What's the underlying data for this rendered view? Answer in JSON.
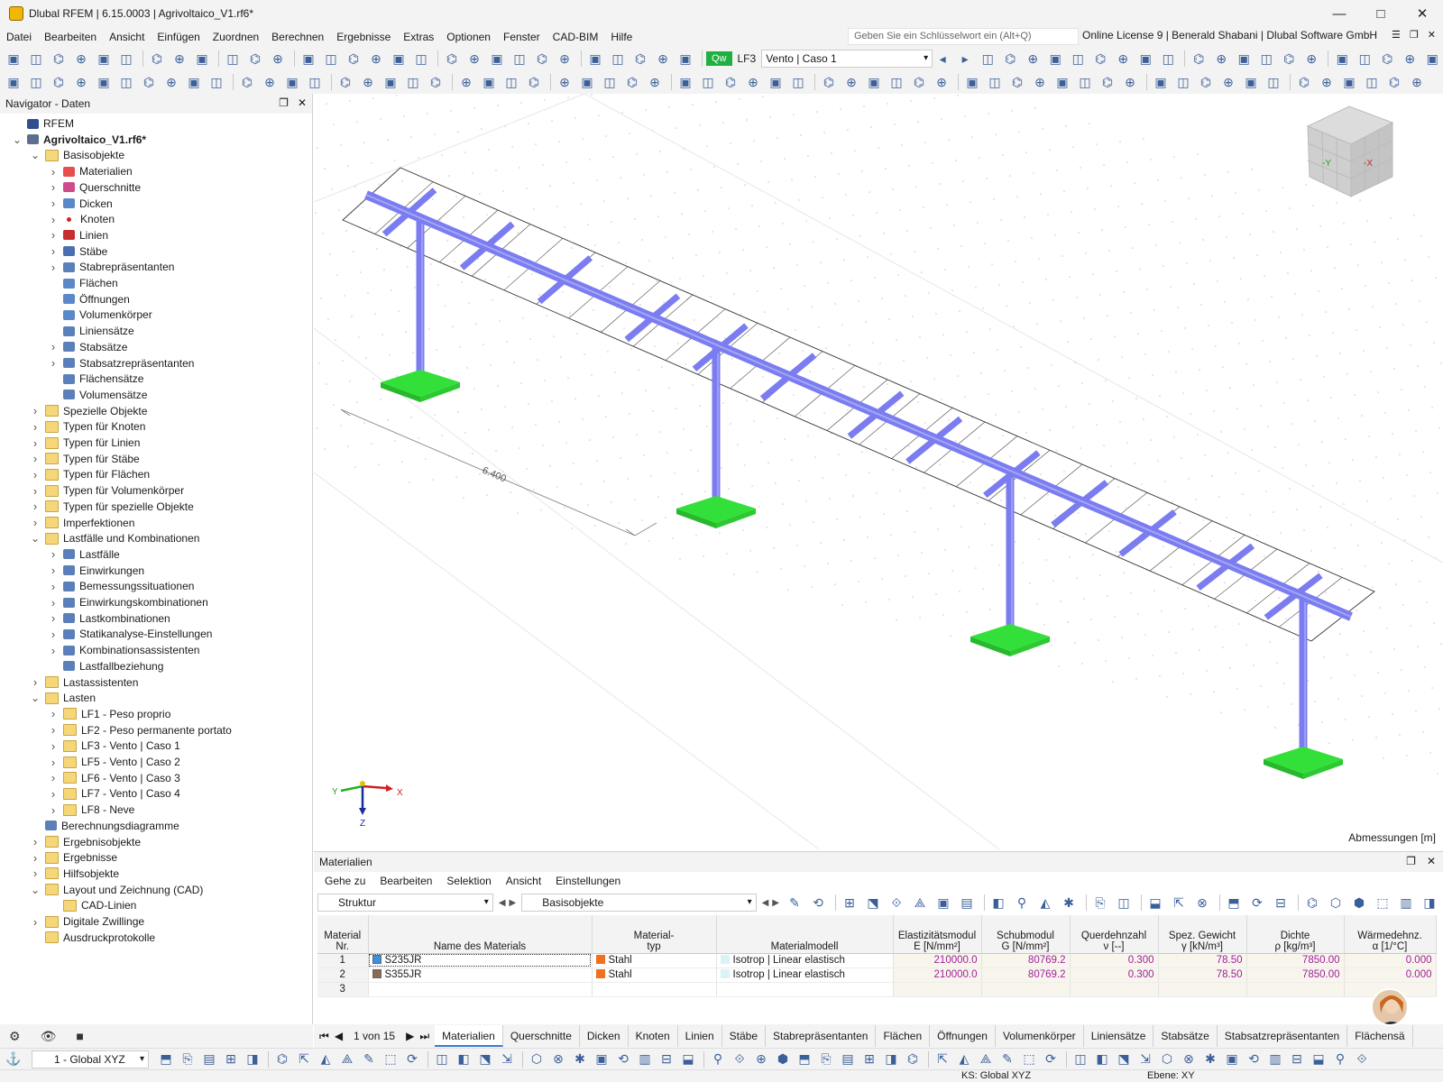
{
  "window": {
    "title": "Dlubal RFEM | 6.15.0003 | Agrivoltaico_V1.rf6*"
  },
  "menu": [
    "Datei",
    "Bearbeiten",
    "Ansicht",
    "Einfügen",
    "Zuordnen",
    "Berechnen",
    "Ergebnisse",
    "Extras",
    "Optionen",
    "Fenster",
    "CAD-BIM",
    "Hilfe"
  ],
  "search": {
    "placeholder": "Geben Sie ein Schlüsselwort ein (Alt+Q)"
  },
  "license": "Online License 9 | Benerald Shabani | Dlubal Software GmbH",
  "loadcase": {
    "badge": "Qw",
    "code": "LF3",
    "name": "Vento | Caso 1"
  },
  "navigator": {
    "title": "Navigator - Daten",
    "items": [
      {
        "label": "RFEM",
        "lvl": 0,
        "exp": "",
        "icon": "rfem-icon"
      },
      {
        "label": "Agrivoltaico_V1.rf6*",
        "lvl": 0,
        "exp": "open",
        "icon": "model-file-icon",
        "bold": true
      },
      {
        "label": "Basisobjekte",
        "lvl": 1,
        "exp": "open",
        "icon": "folder-icon"
      },
      {
        "label": "Materialien",
        "lvl": 2,
        "exp": "closed",
        "icon": "materials-icon"
      },
      {
        "label": "Querschnitte",
        "lvl": 2,
        "exp": "closed",
        "icon": "sections-icon"
      },
      {
        "label": "Dicken",
        "lvl": 2,
        "exp": "closed",
        "icon": "thickness-icon"
      },
      {
        "label": "Knoten",
        "lvl": 2,
        "exp": "closed",
        "icon": "node-icon"
      },
      {
        "label": "Linien",
        "lvl": 2,
        "exp": "closed",
        "icon": "line-icon"
      },
      {
        "label": "Stäbe",
        "lvl": 2,
        "exp": "closed",
        "icon": "member-icon"
      },
      {
        "label": "Stabrepräsentanten",
        "lvl": 2,
        "exp": "closed",
        "icon": "member-rep-icon"
      },
      {
        "label": "Flächen",
        "lvl": 2,
        "exp": "",
        "icon": "surface-icon"
      },
      {
        "label": "Öffnungen",
        "lvl": 2,
        "exp": "",
        "icon": "opening-icon"
      },
      {
        "label": "Volumenkörper",
        "lvl": 2,
        "exp": "",
        "icon": "solid-icon"
      },
      {
        "label": "Liniensätze",
        "lvl": 2,
        "exp": "",
        "icon": "line-set-icon"
      },
      {
        "label": "Stabsätze",
        "lvl": 2,
        "exp": "closed",
        "icon": "member-set-icon"
      },
      {
        "label": "Stabsatzrepräsentanten",
        "lvl": 2,
        "exp": "closed",
        "icon": "member-set-rep-icon"
      },
      {
        "label": "Flächensätze",
        "lvl": 2,
        "exp": "",
        "icon": "surface-set-icon"
      },
      {
        "label": "Volumensätze",
        "lvl": 2,
        "exp": "",
        "icon": "solid-set-icon"
      },
      {
        "label": "Spezielle Objekte",
        "lvl": 1,
        "exp": "closed",
        "icon": "folder-icon"
      },
      {
        "label": "Typen für Knoten",
        "lvl": 1,
        "exp": "closed",
        "icon": "folder-icon"
      },
      {
        "label": "Typen für Linien",
        "lvl": 1,
        "exp": "closed",
        "icon": "folder-icon"
      },
      {
        "label": "Typen für Stäbe",
        "lvl": 1,
        "exp": "closed",
        "icon": "folder-icon"
      },
      {
        "label": "Typen für Flächen",
        "lvl": 1,
        "exp": "closed",
        "icon": "folder-icon"
      },
      {
        "label": "Typen für Volumenkörper",
        "lvl": 1,
        "exp": "closed",
        "icon": "folder-icon"
      },
      {
        "label": "Typen für spezielle Objekte",
        "lvl": 1,
        "exp": "closed",
        "icon": "folder-icon"
      },
      {
        "label": "Imperfektionen",
        "lvl": 1,
        "exp": "closed",
        "icon": "folder-icon"
      },
      {
        "label": "Lastfälle und Kombinationen",
        "lvl": 1,
        "exp": "open",
        "icon": "folder-icon"
      },
      {
        "label": "Lastfälle",
        "lvl": 2,
        "exp": "closed",
        "icon": "load-case-icon"
      },
      {
        "label": "Einwirkungen",
        "lvl": 2,
        "exp": "closed",
        "icon": "actions-icon"
      },
      {
        "label": "Bemessungssituationen",
        "lvl": 2,
        "exp": "closed",
        "icon": "design-situation-icon"
      },
      {
        "label": "Einwirkungskombinationen",
        "lvl": 2,
        "exp": "closed",
        "icon": "action-combination-icon"
      },
      {
        "label": "Lastkombinationen",
        "lvl": 2,
        "exp": "closed",
        "icon": "load-combination-icon"
      },
      {
        "label": "Statikanalyse-Einstellungen",
        "lvl": 2,
        "exp": "closed",
        "icon": "analysis-settings-icon"
      },
      {
        "label": "Kombinationsassistenten",
        "lvl": 2,
        "exp": "closed",
        "icon": "combination-wizard-icon"
      },
      {
        "label": "Lastfallbeziehung",
        "lvl": 2,
        "exp": "",
        "icon": "relationship-icon"
      },
      {
        "label": "Lastassistenten",
        "lvl": 1,
        "exp": "closed",
        "icon": "folder-icon"
      },
      {
        "label": "Lasten",
        "lvl": 1,
        "exp": "open",
        "icon": "folder-icon"
      },
      {
        "label": "LF1 - Peso proprio",
        "lvl": 2,
        "exp": "closed",
        "icon": "folder-icon"
      },
      {
        "label": "LF2 - Peso permanente portato",
        "lvl": 2,
        "exp": "closed",
        "icon": "folder-icon"
      },
      {
        "label": "LF3 - Vento | Caso 1",
        "lvl": 2,
        "exp": "closed",
        "icon": "folder-icon"
      },
      {
        "label": "LF5 - Vento | Caso 2",
        "lvl": 2,
        "exp": "closed",
        "icon": "folder-icon"
      },
      {
        "label": "LF6 - Vento | Caso 3",
        "lvl": 2,
        "exp": "closed",
        "icon": "folder-icon"
      },
      {
        "label": "LF7 - Vento | Caso 4",
        "lvl": 2,
        "exp": "closed",
        "icon": "folder-icon"
      },
      {
        "label": "LF8 - Neve",
        "lvl": 2,
        "exp": "closed",
        "icon": "folder-icon"
      },
      {
        "label": "Berechnungsdiagramme",
        "lvl": 1,
        "exp": "",
        "icon": "diagram-icon"
      },
      {
        "label": "Ergebnisobjekte",
        "lvl": 1,
        "exp": "closed",
        "icon": "folder-icon"
      },
      {
        "label": "Ergebnisse",
        "lvl": 1,
        "exp": "closed",
        "icon": "folder-icon"
      },
      {
        "label": "Hilfsobjekte",
        "lvl": 1,
        "exp": "closed",
        "icon": "folder-icon"
      },
      {
        "label": "Layout und Zeichnung (CAD)",
        "lvl": 1,
        "exp": "open",
        "icon": "folder-icon"
      },
      {
        "label": "CAD-Linien",
        "lvl": 2,
        "exp": "",
        "icon": "folder-icon"
      },
      {
        "label": "Digitale Zwillinge",
        "lvl": 1,
        "exp": "closed",
        "icon": "folder-icon"
      },
      {
        "label": "Ausdruckprotokolle",
        "lvl": 1,
        "exp": "",
        "icon": "folder-icon"
      }
    ]
  },
  "viewport": {
    "dimension_label": "6.400",
    "units_label": "Abmessungen [m]",
    "axes": {
      "x": "X",
      "y": "Y",
      "z": "Z"
    },
    "cube": {
      "y": "-Y",
      "x": "-X"
    },
    "colors": {
      "member": "#7a7cf0",
      "support": "#33e03a",
      "panel_edge": "#333333"
    }
  },
  "materials": {
    "title": "Materialien",
    "menu": [
      "Gehe zu",
      "Bearbeiten",
      "Selektion",
      "Ansicht",
      "Einstellungen"
    ],
    "structure_combo": "Struktur",
    "basis_combo": "Basisobjekte",
    "columns": [
      {
        "l1": "Material",
        "l2": "Nr."
      },
      {
        "l1": "",
        "l2": "Name des Materials"
      },
      {
        "l1": "Material-",
        "l2": "typ"
      },
      {
        "l1": "",
        "l2": "Materialmodell"
      },
      {
        "l1": "Elastizitätsmodul",
        "l2": "E [N/mm²]"
      },
      {
        "l1": "Schubmodul",
        "l2": "G [N/mm²]"
      },
      {
        "l1": "Querdehnzahl",
        "l2": "ν [--]"
      },
      {
        "l1": "Spez. Gewicht",
        "l2": "γ [kN/m³]"
      },
      {
        "l1": "Dichte",
        "l2": "ρ [kg/m³]"
      },
      {
        "l1": "Wärmedehnz.",
        "l2": "α [1/°C]"
      }
    ],
    "rows": [
      {
        "nr": "1",
        "name": "S235JR",
        "name_color": "#3d8fe0",
        "type": "Stahl",
        "type_color": "#f07020",
        "model": "Isotrop | Linear elastisch",
        "E": "210000.0",
        "G": "80769.2",
        "nu": "0.300",
        "gamma": "78.50",
        "rho": "7850.00",
        "alpha": "0.000"
      },
      {
        "nr": "2",
        "name": "S355JR",
        "name_color": "#8a6a50",
        "type": "Stahl",
        "type_color": "#f07020",
        "model": "Isotrop | Linear elastisch",
        "E": "210000.0",
        "G": "80769.2",
        "nu": "0.300",
        "gamma": "78.50",
        "rho": "7850.00",
        "alpha": "0.000"
      },
      {
        "nr": "3",
        "name": "",
        "name_color": "",
        "type": "",
        "type_color": "",
        "model": "",
        "E": "",
        "G": "",
        "nu": "",
        "gamma": "",
        "rho": "",
        "alpha": ""
      }
    ],
    "pager": "1 von 15",
    "tabs": [
      "Materialien",
      "Querschnitte",
      "Dicken",
      "Knoten",
      "Linien",
      "Stäbe",
      "Stabrepräsentanten",
      "Flächen",
      "Öffnungen",
      "Volumenkörper",
      "Liniensätze",
      "Stabsätze",
      "Stabsatzrepräsentanten",
      "Flächensä"
    ]
  },
  "bottom": {
    "coord_system": "1 - Global XYZ"
  },
  "status": {
    "cs": "KS: Global XYZ",
    "plane": "Ebene: XY"
  }
}
